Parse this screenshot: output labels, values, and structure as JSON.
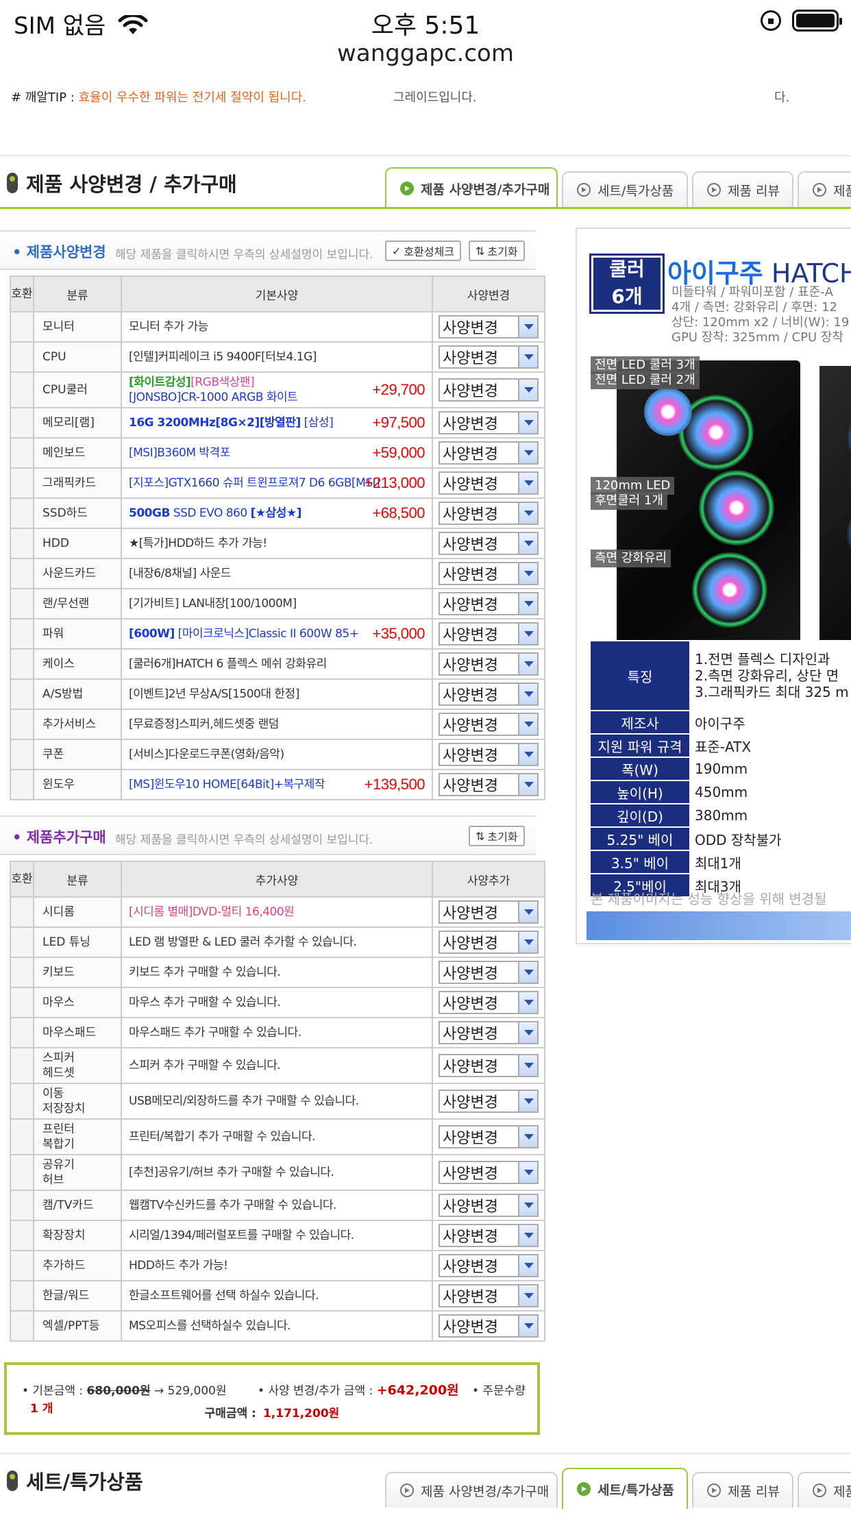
{
  "status": {
    "carrier": "SIM 없음",
    "time": "오후 5:51",
    "url": "wanggapc.com"
  },
  "tips": {
    "label": "# 깨알TIP : ",
    "text": "효율이 우수한 파워는 전기세 절약이 됩니다.",
    "mid": "그레이드입니다.",
    "right": "다."
  },
  "section1": {
    "title": "제품 사양변경 / 추가구매"
  },
  "tabs": [
    "제품 사양변경/추가구매",
    "세트/특가상품",
    "제품 리뷰",
    "제품"
  ],
  "spec": {
    "title": "제품사양변경",
    "desc": "해당 제품을 클릭하시면 우측의 상세설명이 보입니다.",
    "compat_button": "호환성체크",
    "reset_button": "초기화",
    "headers": [
      "호환",
      "분류",
      "기본사양",
      "사양변경"
    ],
    "select_label": "사양변경",
    "rows": [
      {
        "cat": "모니터",
        "spec": "모니터 추가 가능",
        "price": ""
      },
      {
        "cat": "CPU",
        "spec": "[인텔]커피레이크 i5 9400F[터보4.1G]",
        "price": ""
      },
      {
        "cat": "CPU쿨러",
        "spec_a": "[화이트감성]",
        "spec_b": "[RGB색상팬]",
        "spec_c": "[JONSBO]CR-1000 ARGB 화이트",
        "price": "+29,700"
      },
      {
        "cat": "메모리[램]",
        "spec_a": "16G 3200MHz[8G×2][방열판]",
        "spec_b": " [삼성]",
        "price": "+97,500"
      },
      {
        "cat": "메인보드",
        "spec": "[MSI]B360M 박격포",
        "price": "+59,000"
      },
      {
        "cat": "그래픽카드",
        "spec": "[지포스]GTX1660 슈퍼 트윈프로져7 D6 6GB[MSI]",
        "price": "+213,000"
      },
      {
        "cat": "SSD하드",
        "spec_a": "500GB",
        "spec_b": " SSD EVO 860 ",
        "spec_c": "[★삼성★]",
        "price": "+68,500"
      },
      {
        "cat": "HDD",
        "spec": "★[특가]HDD하드 추가 가능!",
        "price": ""
      },
      {
        "cat": "사운드카드",
        "spec": "[내장6/8채널] 사운드",
        "price": ""
      },
      {
        "cat": "랜/무선랜",
        "spec": "[기가비트] LAN내장[100/1000M]",
        "price": ""
      },
      {
        "cat": "파워",
        "spec_a": "[600W]",
        "spec_b": " [마이크로닉스]Classic II 600W 85+",
        "price": "+35,000"
      },
      {
        "cat": "케이스",
        "spec": "[쿨러6개]HATCH 6 플렉스 메쉬 강화유리",
        "price": ""
      },
      {
        "cat": "A/S방법",
        "spec": "[이벤트]2년 무상A/S[1500대 한정]",
        "price": ""
      },
      {
        "cat": "추가서비스",
        "spec": "[무료증정]스피커,헤드셋중 랜덤",
        "price": ""
      },
      {
        "cat": "쿠폰",
        "spec": "[서비스]다운로드쿠폰(영화/음악)",
        "price": ""
      },
      {
        "cat": "윈도우",
        "spec": "[MS]윈도우10 HOME[64Bit]+복구제작",
        "price": "+139,500"
      }
    ]
  },
  "extra": {
    "title": "제품추가구매",
    "desc": "해당 제품을 클릭하시면 우측의 상세설명이 보입니다.",
    "reset_button": "초기화",
    "headers": [
      "호환",
      "분류",
      "추가사양",
      "사양추가"
    ],
    "select_label": "사양변경",
    "rows": [
      {
        "cat": "시디롬",
        "spec": "[시디롬 별매]DVD-멀티 16,400원"
      },
      {
        "cat": "LED 튜닝",
        "spec": "LED 램 방열판 & LED 쿨러 추가할 수 있습니다."
      },
      {
        "cat": "키보드",
        "spec": "키보드 추가 구매할 수 있습니다."
      },
      {
        "cat": "마우스",
        "spec": "마우스 추가 구매할 수 있습니다."
      },
      {
        "cat": "마우스패드",
        "spec": "마우스패드 추가 구매할 수 있습니다."
      },
      {
        "cat": "스피커\n헤드셋",
        "spec": "스피커 추가 구매할 수 있습니다."
      },
      {
        "cat": "이동\n저장장치",
        "spec": "USB메모리/외장하드를 추가 구매할 수 있습니다."
      },
      {
        "cat": "프린터\n복합기",
        "spec": "프린터/복합기 추가 구매할 수 있습니다."
      },
      {
        "cat": "공유기\n허브",
        "spec": "[추천]공유기/허브 추가 구매할 수 있습니다."
      },
      {
        "cat": "캠/TV카드",
        "spec": "웹캠TV수신카드를 추가 구매할 수 있습니다."
      },
      {
        "cat": "확장장치",
        "spec": "시리얼/1394/페러럴포트를 구매할 수 있습니다."
      },
      {
        "cat": "추가하드",
        "spec": "HDD하드 추가 가능!"
      },
      {
        "cat": "한글/워드",
        "spec": "한글소프트웨어를 선택 하실수 있습니다."
      },
      {
        "cat": "엑셀/PPT등",
        "spec": "MS오피스를 선택하실수 있습니다."
      }
    ]
  },
  "summary": {
    "base_label": "• 기본금액 : ",
    "base_old": "680,000원",
    "base_new": "→ 529,000원",
    "change_label": "• 사양 변경/추가 금액 : ",
    "change_value": "+642,200원",
    "qty_label": "• 주문수량",
    "qty_value": "1 개",
    "total_label": "구매금액 :",
    "total_value": "1,171,200원"
  },
  "product": {
    "badge_line1": "쿨러",
    "badge_line2": "6개",
    "name_a": "아이구주",
    "name_b": " HATCH ",
    "info": [
      "미들타워 / 파워미포함 / 표준-A",
      "4개 / 측면: 강화유리 / 후면: 12",
      "상단: 120mm x2 / 너비(W): 19",
      "GPU 장착: 325mm / CPU 장착"
    ],
    "labels": [
      "전면 LED 쿨러 3개",
      "전면 LED 쿨러 2개",
      "120mm LED",
      "후면쿨러 1개",
      "측면 강화유리"
    ],
    "feature_key": "특징",
    "feature_lines": [
      "1.전면 플렉스 디자인과 ",
      "2.측면 강화유리, 상단 면",
      "3.그래픽카드 최대 325 m"
    ],
    "specs": [
      {
        "k": "제조사",
        "v": "아이구주"
      },
      {
        "k": "지원 파워 규격",
        "v": "표준-ATX"
      },
      {
        "k": "폭(W)",
        "v": "190mm"
      },
      {
        "k": "높이(H)",
        "v": "450mm"
      },
      {
        "k": "깊이(D)",
        "v": "380mm"
      },
      {
        "k": "5.25\" 베이",
        "v": "ODD 장착불가"
      },
      {
        "k": "3.5\" 베이",
        "v": "최대1개"
      },
      {
        "k": "2.5\"베이",
        "v": "최대3개"
      }
    ],
    "note": "본 제품이미지는 성능 향상을 위해 변경될"
  },
  "section2": {
    "title": "세트/특가상품"
  }
}
